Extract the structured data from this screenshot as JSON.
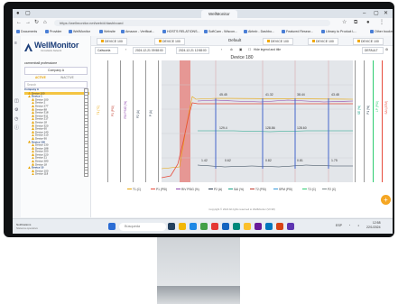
{
  "browser": {
    "tab_title": "WellMonitor",
    "url": "https://wellmonitor.net/web/#/dashboard",
    "bookmarks": [
      "Documents",
      "Provider",
      "WellMonitor",
      "Website",
      "Amazon - Verificat...",
      "HOSTS RELATIONS...",
      "SoftCam - Wiscon...",
      "Airbnb - Dashbo...",
      "Featured Resear...",
      "Library to Product L..."
    ],
    "other_bookmarks": "Other bookm"
  },
  "sidebar": {
    "logo": "WellMonitor",
    "logo_sub": "Consultants Network",
    "organization": "carmenball professione",
    "company": "Company A",
    "status_tabs": [
      "ACTIVE",
      "INACTIVE"
    ],
    "search_placeholder": "Search",
    "tree": [
      {
        "label": "Company A",
        "level": 0,
        "kind": "group"
      },
      {
        "label": "Device 100",
        "level": 1,
        "kind": "highlight"
      },
      {
        "label": "Device 1",
        "level": 1,
        "kind": "group"
      },
      {
        "label": "Device 100",
        "level": 2,
        "kind": "item"
      },
      {
        "label": "Device 2",
        "level": 2,
        "kind": "item"
      },
      {
        "label": "Device 277",
        "level": 2,
        "kind": "item"
      },
      {
        "label": "Device 88",
        "level": 2,
        "kind": "item"
      },
      {
        "label": "Device 318",
        "level": 2,
        "kind": "item"
      },
      {
        "label": "Device 911",
        "level": 2,
        "kind": "item"
      },
      {
        "label": "Device 217",
        "level": 2,
        "kind": "item"
      },
      {
        "label": "Device 18",
        "level": 2,
        "kind": "item"
      },
      {
        "label": "Device 320",
        "level": 2,
        "kind": "item"
      },
      {
        "label": "Device 60",
        "level": 2,
        "kind": "item"
      },
      {
        "label": "Device 140",
        "level": 2,
        "kind": "item"
      },
      {
        "label": "Device 210",
        "level": 2,
        "kind": "item"
      },
      {
        "label": "Device 90",
        "level": 2,
        "kind": "item"
      },
      {
        "label": "Device 100",
        "level": 1,
        "kind": "group"
      },
      {
        "label": "Device 130",
        "level": 2,
        "kind": "item"
      },
      {
        "label": "Device 188",
        "level": 2,
        "kind": "item"
      },
      {
        "label": "Device 200",
        "level": 2,
        "kind": "item"
      },
      {
        "label": "Device 220",
        "level": 2,
        "kind": "item"
      },
      {
        "label": "Device 21",
        "level": 2,
        "kind": "item"
      },
      {
        "label": "Device 280",
        "level": 2,
        "kind": "item"
      },
      {
        "label": "Device 18",
        "level": 2,
        "kind": "item"
      },
      {
        "label": "Device 10",
        "level": 1,
        "kind": "group"
      },
      {
        "label": "Device 100",
        "level": 2,
        "kind": "item"
      },
      {
        "label": "Device 118",
        "level": 2,
        "kind": "item"
      }
    ]
  },
  "main": {
    "device_tabs": [
      "DEVICE 100",
      "DEVICE 100",
      "DEVICE 100",
      "DEVICE 100",
      "DEVICE 100"
    ],
    "default_label": "Default",
    "toolbar": {
      "range": "Caliwuela",
      "date_from": "2024-12-21 09:58:00",
      "date_to": "2024-12-21 12:58:00",
      "checkbox_label": "Hide legend and title",
      "right_select": "DEFAULT"
    },
    "device_title": "Device 180",
    "axes_left": [
      "T1 (°C)",
      "P1 (PSI)",
      "RIV PSIG (%)",
      "P2 (A)",
      "P (A)"
    ],
    "axes_right": [
      "SE (%)",
      "P1 (%)",
      "LP (PSI)",
      "SAI (ATM)"
    ],
    "annotations": [
      "45.45",
      "41.32",
      "38.44",
      "43.48",
      "129.4",
      "128.86",
      "128.60",
      "1.42",
      "0.62",
      "0.82",
      "0.81",
      "1.75"
    ],
    "legend": [
      "T1 (C)",
      "P1 (PSI)",
      "RIV PSIG (%)",
      "P2 (A)",
      "SAI (%)",
      "T2 (PSI)",
      "SPM (PSI)",
      "T2 (C)",
      "P2 (C)"
    ],
    "footer": "Copyright © 2024 All rights reserved to WellMonitor (V0.98)"
  },
  "taskbar": {
    "notification_title": "Notifications",
    "notification_sub": "Sistema operativo",
    "search_placeholder": "Búsqueda",
    "language": "ESP",
    "time": "12:58",
    "date": "22/1/2024"
  },
  "colors": {
    "brand": "#1d3f7a",
    "accent": "#f5a623",
    "alarm": "#e74c3c"
  }
}
